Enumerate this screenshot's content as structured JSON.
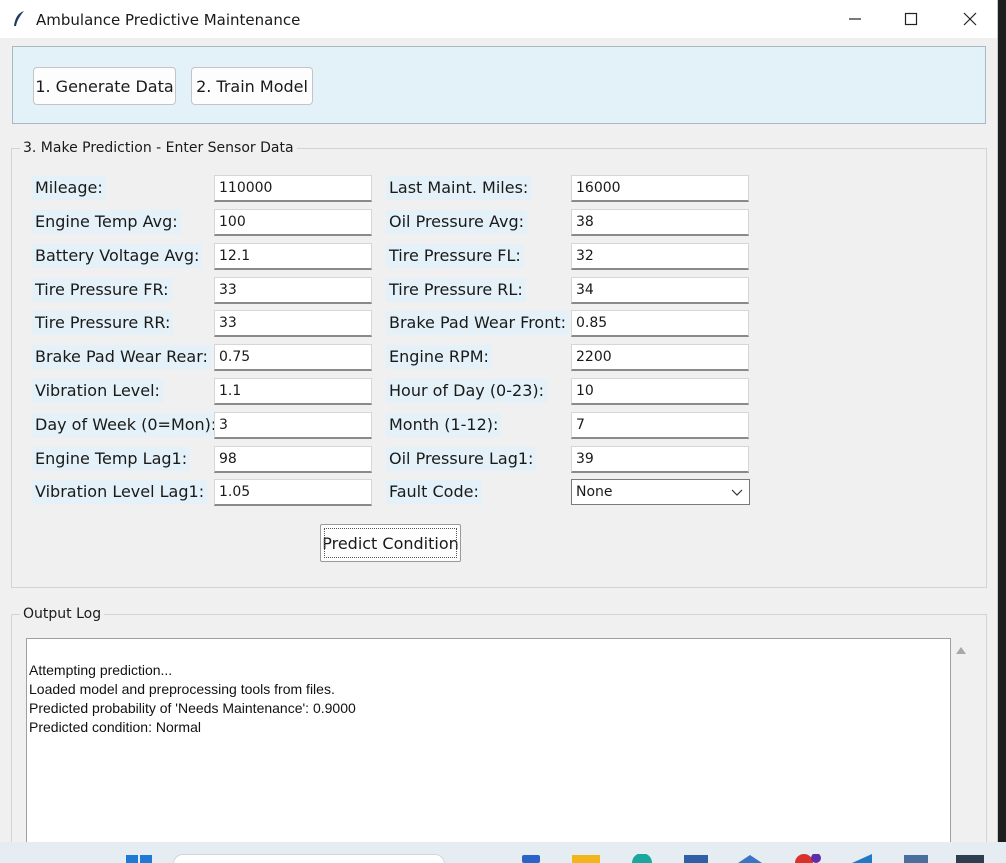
{
  "window": {
    "title": "Ambulance Predictive Maintenance"
  },
  "toolbar": {
    "generate_label": "1. Generate Data",
    "train_label": "2. Train Model"
  },
  "prediction": {
    "group_label": "3. Make Prediction - Enter Sensor Data",
    "fields": [
      {
        "label": "Mileage:",
        "value": "110000"
      },
      {
        "label": "Last Maint. Miles:",
        "value": "16000"
      },
      {
        "label": "Engine Temp Avg:",
        "value": "100"
      },
      {
        "label": "Oil Pressure Avg:",
        "value": "38"
      },
      {
        "label": "Battery Voltage Avg:",
        "value": "12.1"
      },
      {
        "label": "Tire Pressure FL:",
        "value": "32"
      },
      {
        "label": "Tire Pressure FR:",
        "value": "33"
      },
      {
        "label": "Tire Pressure RL:",
        "value": "34"
      },
      {
        "label": "Tire Pressure RR:",
        "value": "33"
      },
      {
        "label": "Brake Pad Wear Front:",
        "value": "0.85"
      },
      {
        "label": "Brake Pad Wear Rear:",
        "value": "0.75"
      },
      {
        "label": "Engine RPM:",
        "value": "2200"
      },
      {
        "label": "Vibration Level:",
        "value": "1.1"
      },
      {
        "label": "Hour of Day (0-23):",
        "value": "10"
      },
      {
        "label": "Day of Week (0=Mon):",
        "value": "3"
      },
      {
        "label": "Month (1-12):",
        "value": "7"
      },
      {
        "label": "Engine Temp Lag1:",
        "value": "98"
      },
      {
        "label": "Oil Pressure Lag1:",
        "value": "39"
      },
      {
        "label": "Vibration Level Lag1:",
        "value": "1.05"
      },
      {
        "label": "Fault Code:",
        "value": "None"
      }
    ],
    "predict_label": "Predict Condition"
  },
  "log": {
    "group_label": "Output Log",
    "lines": [
      "Attempting prediction...",
      "Loaded model and preprocessing tools from files.",
      "Predicted probability of 'Needs Maintenance': 0.9000",
      "Predicted condition: Normal"
    ]
  },
  "colors": {
    "toolbar_bg": "#e3f1f9",
    "label_bg": "#e4f1f8",
    "window_bg": "#f0f0f0"
  }
}
